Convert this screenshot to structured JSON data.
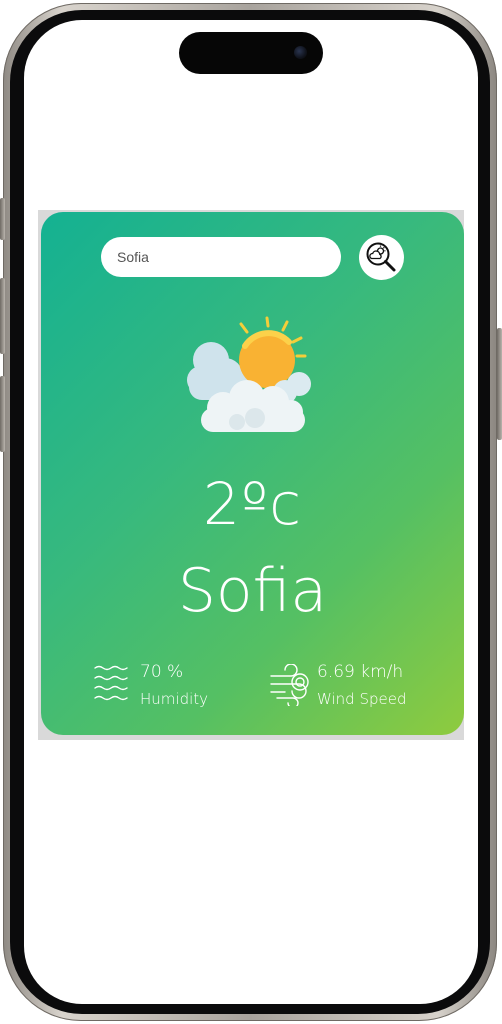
{
  "search": {
    "value": "Sofia",
    "icon": "weather-search-icon"
  },
  "weather": {
    "icon": "partly-cloudy-icon",
    "temperature": "2ºc",
    "city": "Sofia"
  },
  "details": {
    "humidity": {
      "value": "70 %",
      "label": "Humidity",
      "icon": "humidity-waves-icon"
    },
    "wind": {
      "value": "6.69 km/h",
      "label": "Wind Speed",
      "icon": "wind-icon"
    }
  },
  "colors": {
    "gradient_start": "#14b192",
    "gradient_end": "#8fcb3e",
    "text": "#ffffff"
  }
}
